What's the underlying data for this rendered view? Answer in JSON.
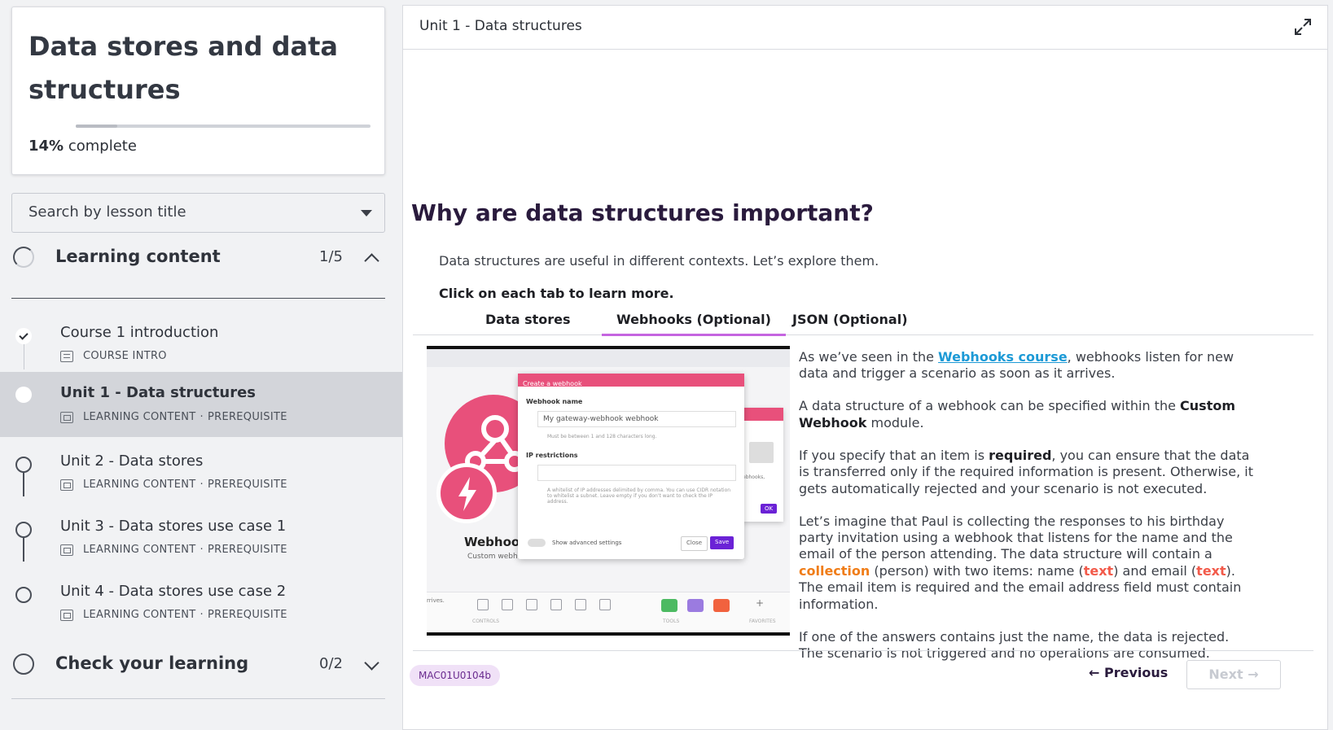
{
  "sidebar": {
    "course_title": "Data stores and data structures",
    "progress_percent": 14,
    "progress_value": "14%",
    "progress_suffix": "complete",
    "search_placeholder": "Search by lesson title",
    "sections": [
      {
        "title": "Learning content",
        "count": "1/5",
        "expanded": true,
        "lessons": [
          {
            "title": "Course 1 introduction",
            "type": "COURSE INTRO",
            "tag": "",
            "status": "completed"
          },
          {
            "title": "Unit 1 - Data structures",
            "type": "LEARNING CONTENT",
            "tag": "PREREQUISITE",
            "status": "current"
          },
          {
            "title": "Unit 2 - Data stores",
            "type": "LEARNING CONTENT",
            "tag": "PREREQUISITE",
            "status": "not-started"
          },
          {
            "title": "Unit 3 - Data stores use case 1",
            "type": "LEARNING CONTENT",
            "tag": "PREREQUISITE",
            "status": "not-started"
          },
          {
            "title": "Unit 4 - Data stores use case 2",
            "type": "LEARNING CONTENT",
            "tag": "PREREQUISITE",
            "status": "not-started"
          }
        ]
      },
      {
        "title": "Check your learning",
        "count": "0/2",
        "expanded": false
      }
    ],
    "meta_separator": "·"
  },
  "main": {
    "header_title": "Unit 1 - Data structures",
    "heading": "Why are data structures important?",
    "intro": "Data structures are useful in different contexts. Let’s explore them.",
    "instruction": "Click on each tab to learn more.",
    "tabs": [
      {
        "label": "Data stores",
        "active": false
      },
      {
        "label": "Webhooks (Optional)",
        "active": true
      },
      {
        "label": "JSON (Optional)",
        "active": false
      }
    ],
    "content": {
      "p1_before": "As we’ve seen in the ",
      "p1_link": "Webhooks course",
      "p1_after": ", webhooks listen for new data and trigger a scenario as soon as it arrives.",
      "p2_before": "A data structure of a webhook can be specified within the ",
      "p2_bold": "Custom Webhook",
      "p2_after": " module.",
      "p3_before": "If you specify that an item is ",
      "p3_bold": "required",
      "p3_after": ", you can ensure that the data is transferred only if the required information is present. Otherwise, it gets automatically rejected and your scenario is not executed.",
      "p4_a": "Let’s imagine that Paul is collecting the responses to his birthday party invitation using a webhook that listens for the name and the email of the person attending. The data structure will contain a ",
      "p4_collection": "collection",
      "p4_b": " (person) with two items: name (",
      "p4_text1": "text",
      "p4_c": ") and email (",
      "p4_text2": "text",
      "p4_d": "). The email item is required and the email address field must contain information.",
      "p5": "If one of the answers contains just the name, the data is rejected. The scenario is not triggered and no operations are consumed."
    },
    "screenshot": {
      "dialog_title": "Create a webhook",
      "field1_label": "Webhook name",
      "field1_value": "My gateway-webhook webhook",
      "field1_note": "Must be between 1 and 128 characters long.",
      "field2_label": "IP restrictions",
      "field2_note": "A whitelist of IP addresses delimited by comma. You can use CIDR notation to whitelist a subnet. Leave empty if you don't want to check the IP address.",
      "toggle_label": "Show advanced settings",
      "close_label": "Close",
      "save_label": "Save",
      "ok_label": "OK",
      "module_name": "Webhoo",
      "module_sub": "Custom webh",
      "side_label": "ebhooks,",
      "toolbar_left": "rrives.",
      "cap_controls": "CONTROLS",
      "cap_tools": "TOOLS",
      "cap_favorites": "FAVORITES"
    },
    "footer": {
      "badge": "MAC01U0104b",
      "previous": "← Previous",
      "next": "Next →"
    }
  },
  "colors": {
    "accent_purple": "#c565e0",
    "link_blue": "#1d9ad6",
    "collection_orange": "#f07d18",
    "text_red": "#f25a4a",
    "badge_bg": "#f0e1f7",
    "make_pink": "#e8507b"
  },
  "icons": {
    "expand": "expand-arrows-icon",
    "caret": "caret-down-icon",
    "check": "check-icon",
    "lesson_doc": "document-icon",
    "lesson_media": "media-icon"
  }
}
